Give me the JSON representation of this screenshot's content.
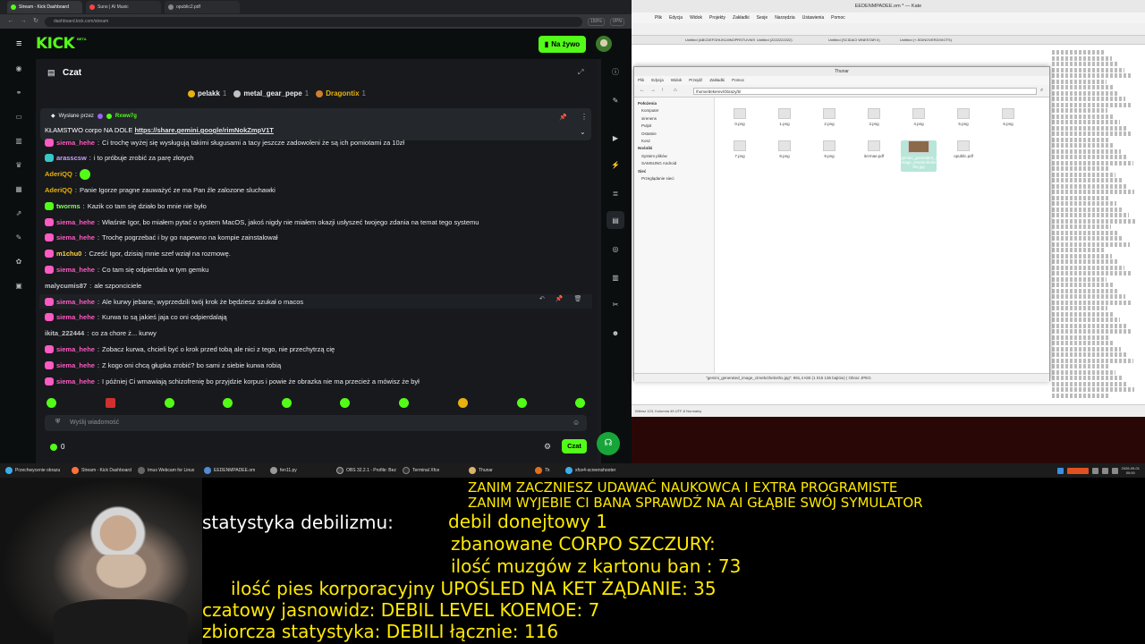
{
  "browser": {
    "tabs": [
      "Stream - Kick Dashboard",
      "Suno | AI Music",
      "opublic2.pdf"
    ],
    "url": "dashboard.kick.com/stream",
    "zoom": "150%",
    "vpn": "VPN"
  },
  "kick": {
    "logo": "KICK",
    "beta": "BETA",
    "go_live": "Na żywo",
    "chat_title": "Czat",
    "top_gifters": [
      {
        "name": "pelakk",
        "count": "1"
      },
      {
        "name": "metal_gear_pepe",
        "count": "1"
      },
      {
        "name": "Dragontix",
        "count": "1"
      }
    ],
    "pinned": {
      "sent_by_label": "Wysłane przez",
      "sender": "Rxww7g",
      "text": "KŁAMSTWO corpo NA DOLE ",
      "link": "https://share.gemini.google/rimNokZmpV1T"
    },
    "messages": [
      {
        "user": "siema_hehe",
        "text": "Ci trochę wyżej się wysługują takimi sługusami a tacy jeszcze zadowoleni że są ich pomiotami za 10zł",
        "color": "#ff5ac3",
        "badge": "pink"
      },
      {
        "user": "arasscsw",
        "text": "i to próbuje zrobić za parę złotych",
        "color": "#c8a0ff",
        "badge": "teal"
      },
      {
        "user": "AderiQQ",
        "text": "",
        "color": "#e8b10f",
        "badge": "none"
      },
      {
        "user": "AderiQQ",
        "text": "Panie Igorze pragne zauważyć ze ma Pan źle zalozone sluchawki",
        "color": "#e8b10f",
        "badge": "none"
      },
      {
        "user": "tworms",
        "text": "Kazik co tam się działo bo mnie nie było",
        "color": "#7dff5a",
        "badge": "green"
      },
      {
        "user": "siema_hehe",
        "text": "Właśnie Igor, bo miałem pytać o system MacOS, jakoś nigdy nie miałem okazji usłyszeć twojego zdania na temat tego systemu",
        "color": "#ff5ac3",
        "badge": "pink"
      },
      {
        "user": "siema_hehe",
        "text": "Trochę pogrzebać i by go napewno na kompie zainstalował",
        "color": "#ff5ac3",
        "badge": "pink"
      },
      {
        "user": "m1chu0",
        "text": "Cześć Igor, dzisiaj mnie szef wziął na rozmowę.",
        "color": "#ffd24a",
        "badge": "pink"
      },
      {
        "user": "siema_hehe",
        "text": "Co tam się odpierdala w tym gemku",
        "color": "#ff5ac3",
        "badge": "pink"
      },
      {
        "user": "malycumis87",
        "text": "ale szponciciele",
        "color": "#c0c4c8",
        "badge": "none"
      },
      {
        "user": "siema_hehe",
        "text": "Ale kurwy jebane, wyprzedzili twój krok że będziesz szukał o macos",
        "color": "#ff5ac3",
        "badge": "pink"
      },
      {
        "user": "siema_hehe",
        "text": "Kurwa to są jakieś jaja co oni odpierdalają",
        "color": "#ff5ac3",
        "badge": "pink"
      },
      {
        "user": "ikita_222444",
        "text": "co za chore ż... kurwy",
        "color": "#c0c4c8",
        "badge": "none"
      },
      {
        "user": "siema_hehe",
        "text": "Zobacz kurwa, chcieli być o krok przed tobą ale nici z tego, nie przechytrzą cię",
        "color": "#ff5ac3",
        "badge": "pink"
      },
      {
        "user": "siema_hehe",
        "text": "Z kogo oni chcą głupka zrobić? bo sami z siebie kurwa robią",
        "color": "#ff5ac3",
        "badge": "pink"
      },
      {
        "user": "siema_hehe",
        "text": "I później Ci wmawiają schizofrenię bo przyjdzie korpus i powie że obrazka nie ma przecież a mówisz że był",
        "color": "#ff5ac3",
        "badge": "pink"
      }
    ],
    "input_placeholder": "Wyślij wiadomość",
    "points": "0",
    "send_label": "Czat"
  },
  "kate": {
    "title": "EEDENMPADEE.om * — Kate",
    "menu": [
      "Plik",
      "Edycja",
      "Widok",
      "Projekty",
      "Zakładki",
      "Sesje",
      "Narzędzia",
      "Ustawienia",
      "Pomoc"
    ],
    "tabs": [
      "Untitled (ABCDEFGHIJKLMNOPRSTUVWXYZ)",
      "Untitled (2222222222)",
      "Untitled (SCIDACI WNESTAR II)",
      "Untitled (+-SDINOVERDIVIOTS)"
    ],
    "status": "Wiersz 123, Kolumna 45   UTF-8   Normalny"
  },
  "thunar": {
    "title": "Thunar",
    "menu": [
      "Plik",
      "Edycja",
      "Widok",
      "Przejdź",
      "Zakładki",
      "Pomoc"
    ],
    "path": "/home/dekerev/Obrazy/ti/",
    "sidebar": [
      {
        "label": "Położenia",
        "head": true
      },
      {
        "label": "Komputer",
        "head": false
      },
      {
        "label": "sirenens",
        "head": false
      },
      {
        "label": "Pulpit",
        "head": false
      },
      {
        "label": "Ostatnie",
        "head": false
      },
      {
        "label": "Kosz",
        "head": false
      },
      {
        "label": "Nośniki",
        "head": true
      },
      {
        "label": "System plików",
        "head": false
      },
      {
        "label": "SAMSUNG Android",
        "head": false
      },
      {
        "label": "Sieć",
        "head": true
      },
      {
        "label": "Przeglądanie sieci",
        "head": false
      }
    ],
    "files": [
      "0.png",
      "1.png",
      "2.png",
      "3.png",
      "4.png",
      "5.png",
      "6.png",
      "7.png",
      "8.png",
      "9.png",
      "itcrmae.pdf",
      "gemini_generated_image_ctmebcthebxthx.jpg",
      "opublic.pdf"
    ],
    "status": "\"gemini_generated_image_ctmebcthebxthx.jpg\": 991,4 KiB (1 015 136 bajtów) | Obraz JPEG"
  },
  "taskbar": {
    "items": [
      "Przechwycenie obrazu",
      "Stream - Kick Dashboard",
      "Imus Webcam for Linux",
      "EEDENMPADEE.om",
      "fen11.py",
      "OBS 32.2.1 - Profile: Bez",
      "Terminal Xfce",
      "Thunar",
      "Tk",
      "xfce4-screenshooter"
    ],
    "clock_date": "2026-09-01",
    "clock_time": "00:00"
  },
  "overlay": {
    "line1": "ZANIM ZACZNIESZ UDAWAĆ NAUKOWCA I EXTRA PROGRAMISTE",
    "line2": "ZANIM WYJEBIE CI BANA SPRAWDŹ NA AI GŁĄBIE SWÓJ SYMULATOR",
    "stat_label": "statystyka debilizmu:",
    "donation": "debil donejtowy 1",
    "banned": "zbanowane CORPO SZCZURY:",
    "brains": "ilość muzgów z kartonu ban : 73",
    "dogs": "ilość pies korporacyjny UPOŚLED NA KET ŻĄDANIE: 35",
    "clairvoyant": "czatowy jasnowidz: DEBIL LEVEL KOEMOE: 7",
    "total": "zbiorcza statystyka: DEBILI łącznie: 116"
  }
}
